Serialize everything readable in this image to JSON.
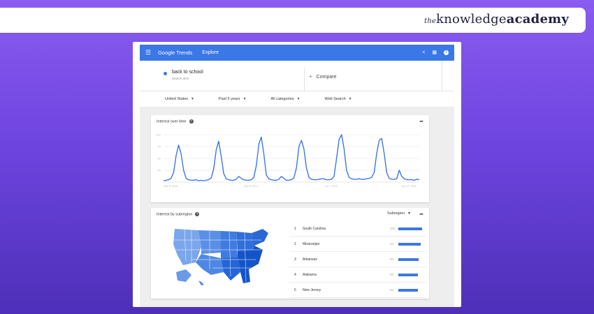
{
  "brand": {
    "prefix": "the",
    "word1": "knowledge",
    "word2": "academy"
  },
  "header": {
    "logo": "Google Trends",
    "section": "Explore"
  },
  "search": {
    "term": "back to school",
    "term_type": "Search term",
    "compare_label": "Compare"
  },
  "filters": [
    {
      "label": "United States"
    },
    {
      "label": "Past 5 years"
    },
    {
      "label": "All categories"
    },
    {
      "label": "Web Search"
    }
  ],
  "interest_over_time": {
    "title": "Interest over time",
    "chart_data": {
      "type": "line",
      "ylim": [
        0,
        100
      ],
      "y_ticks": [
        "100",
        "75",
        "50",
        "25"
      ],
      "x_tick_labels": [
        "Mar 6, 2016",
        "Nov 5, 2017",
        "Jul 7, 2019",
        "Jun 13, 2021"
      ],
      "series": [
        {
          "values": [
            3,
            4,
            5,
            8,
            20,
            55,
            78,
            60,
            25,
            8,
            5,
            4,
            4,
            5,
            3,
            4,
            3,
            4,
            5,
            9,
            28,
            68,
            86,
            55,
            18,
            7,
            5,
            4,
            4,
            6,
            12,
            8,
            5,
            4,
            4,
            5,
            10,
            35,
            80,
            95,
            60,
            15,
            7,
            5,
            4,
            4,
            6,
            12,
            8,
            4,
            4,
            5,
            9,
            30,
            75,
            88,
            70,
            30,
            10,
            6,
            5,
            5,
            6,
            7,
            7,
            5,
            5,
            6,
            12,
            50,
            90,
            100,
            70,
            25,
            10,
            7,
            6,
            6,
            7,
            6,
            6,
            7,
            8,
            10,
            20,
            60,
            88,
            92,
            60,
            20,
            8,
            6,
            6,
            7,
            25,
            12,
            7,
            5,
            5,
            5,
            4,
            6,
            5
          ]
        }
      ]
    }
  },
  "interest_by_subregion": {
    "title": "Interest by subregion",
    "dropdown": "Subregion",
    "rankings": [
      {
        "rank": "1",
        "name": "South Carolina",
        "value": "100",
        "share": 1.0
      },
      {
        "rank": "2",
        "name": "Mississippi",
        "value": "93",
        "share": 0.93
      },
      {
        "rank": "3",
        "name": "Arkansas",
        "value": "85",
        "share": 0.85
      },
      {
        "rank": "4",
        "name": "Alabama",
        "value": "83",
        "share": 0.83
      },
      {
        "rank": "5",
        "name": "New Jersey",
        "value": "83",
        "share": 0.83
      }
    ]
  },
  "colors": {
    "accent": "#3b78e7",
    "map_light": "#6a9ae8",
    "map_dark": "#1a5fd6"
  }
}
